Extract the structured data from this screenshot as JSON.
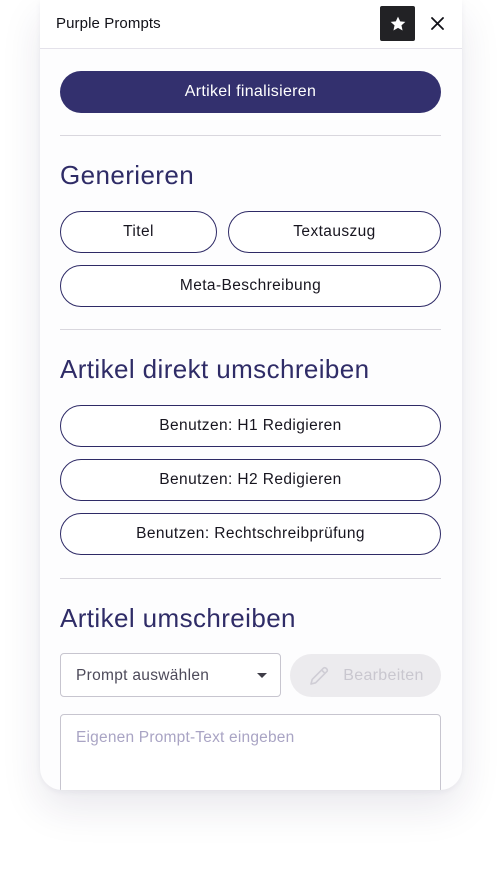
{
  "header": {
    "title": "Purple Prompts"
  },
  "actions": {
    "finalize_label": "Artikel finalisieren"
  },
  "generate": {
    "title": "Generieren",
    "buttons": [
      "Titel",
      "Textauszug",
      "Meta-Beschreibung"
    ]
  },
  "rewrite_direct": {
    "title": "Artikel direkt umschreiben",
    "buttons": [
      "Benutzen: H1 Redigieren",
      "Benutzen: H2 Redigieren",
      "Benutzen: Rechtschreibprüfung"
    ]
  },
  "rewrite": {
    "title": "Artikel umschreiben",
    "select_placeholder": "Prompt auswählen",
    "edit_label": "Bearbeiten",
    "textarea_placeholder": "Eigenen Prompt-Text eingeben"
  },
  "icons": {
    "star": "star-icon",
    "close": "close-icon",
    "caret": "caret-down-icon",
    "pencil": "pencil-icon"
  },
  "colors": {
    "primary": "#33306e",
    "heading": "#2f2c67",
    "disabled_bg": "#ecebee",
    "disabled_text": "#c9c7cf",
    "placeholder": "#a9a4c4"
  }
}
